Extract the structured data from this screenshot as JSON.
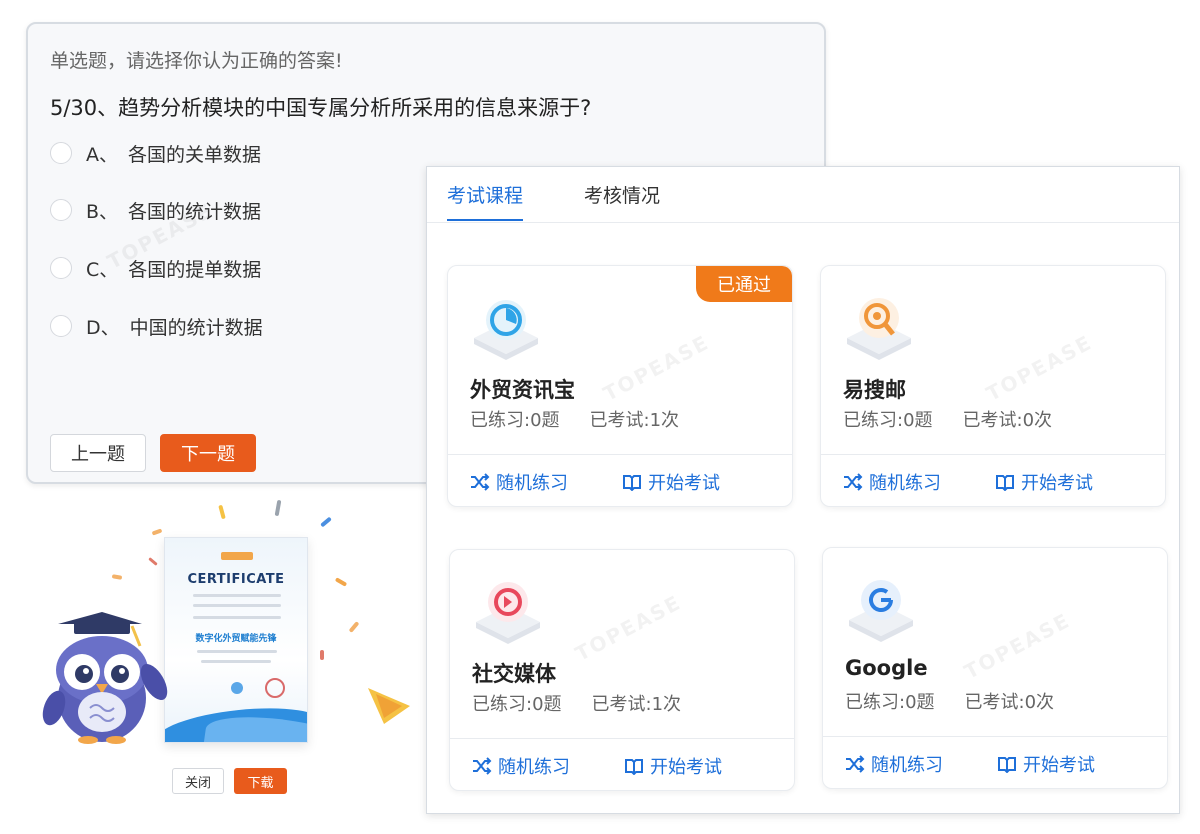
{
  "quiz": {
    "hint": "单选题，请选择你认为正确的答案!",
    "question": "5/30、趋势分析模块的中国专属分析所采用的信息来源于?",
    "options": [
      {
        "letter": "A、",
        "text": "各国的关单数据"
      },
      {
        "letter": "B、",
        "text": "各国的统计数据"
      },
      {
        "letter": "C、",
        "text": "各国的提单数据"
      },
      {
        "letter": "D、",
        "text": "中国的统计数据"
      }
    ],
    "prev_label": "上一题",
    "next_label": "下一题",
    "watermark": "TOPEASE"
  },
  "certificate": {
    "title": "CERTIFICATE",
    "subtitle": "数字化外贸赋能先锋",
    "close_label": "关闭",
    "download_label": "下载"
  },
  "exam": {
    "tabs": [
      {
        "label": "考试课程",
        "active": true
      },
      {
        "label": "考核情况",
        "active": false
      }
    ],
    "watermark": "TOPEASE",
    "practice_label": "随机练习",
    "exam_label": "开始考试",
    "cards": [
      {
        "name": "外贸资讯宝",
        "practiced": "已练习:0题",
        "tested": "已考试:1次",
        "badge": "已通过",
        "icon": "chart-clock-icon",
        "accent": "#2fa4e7"
      },
      {
        "name": "易搜邮",
        "practiced": "已练习:0题",
        "tested": "已考试:0次",
        "badge": "",
        "icon": "search-magnifier-icon",
        "accent": "#f0963a"
      },
      {
        "name": "社交媒体",
        "practiced": "已练习:0题",
        "tested": "已考试:1次",
        "badge": "",
        "icon": "social-media-icon",
        "accent": "#e8485c"
      },
      {
        "name": "Google",
        "practiced": "已练习:0题",
        "tested": "已考试:0次",
        "badge": "",
        "icon": "google-g-icon",
        "accent": "#2a7de1"
      }
    ]
  },
  "colors": {
    "primary": "#1e6fd9",
    "orange": "#e85b1c",
    "badge": "#f07a1a"
  }
}
